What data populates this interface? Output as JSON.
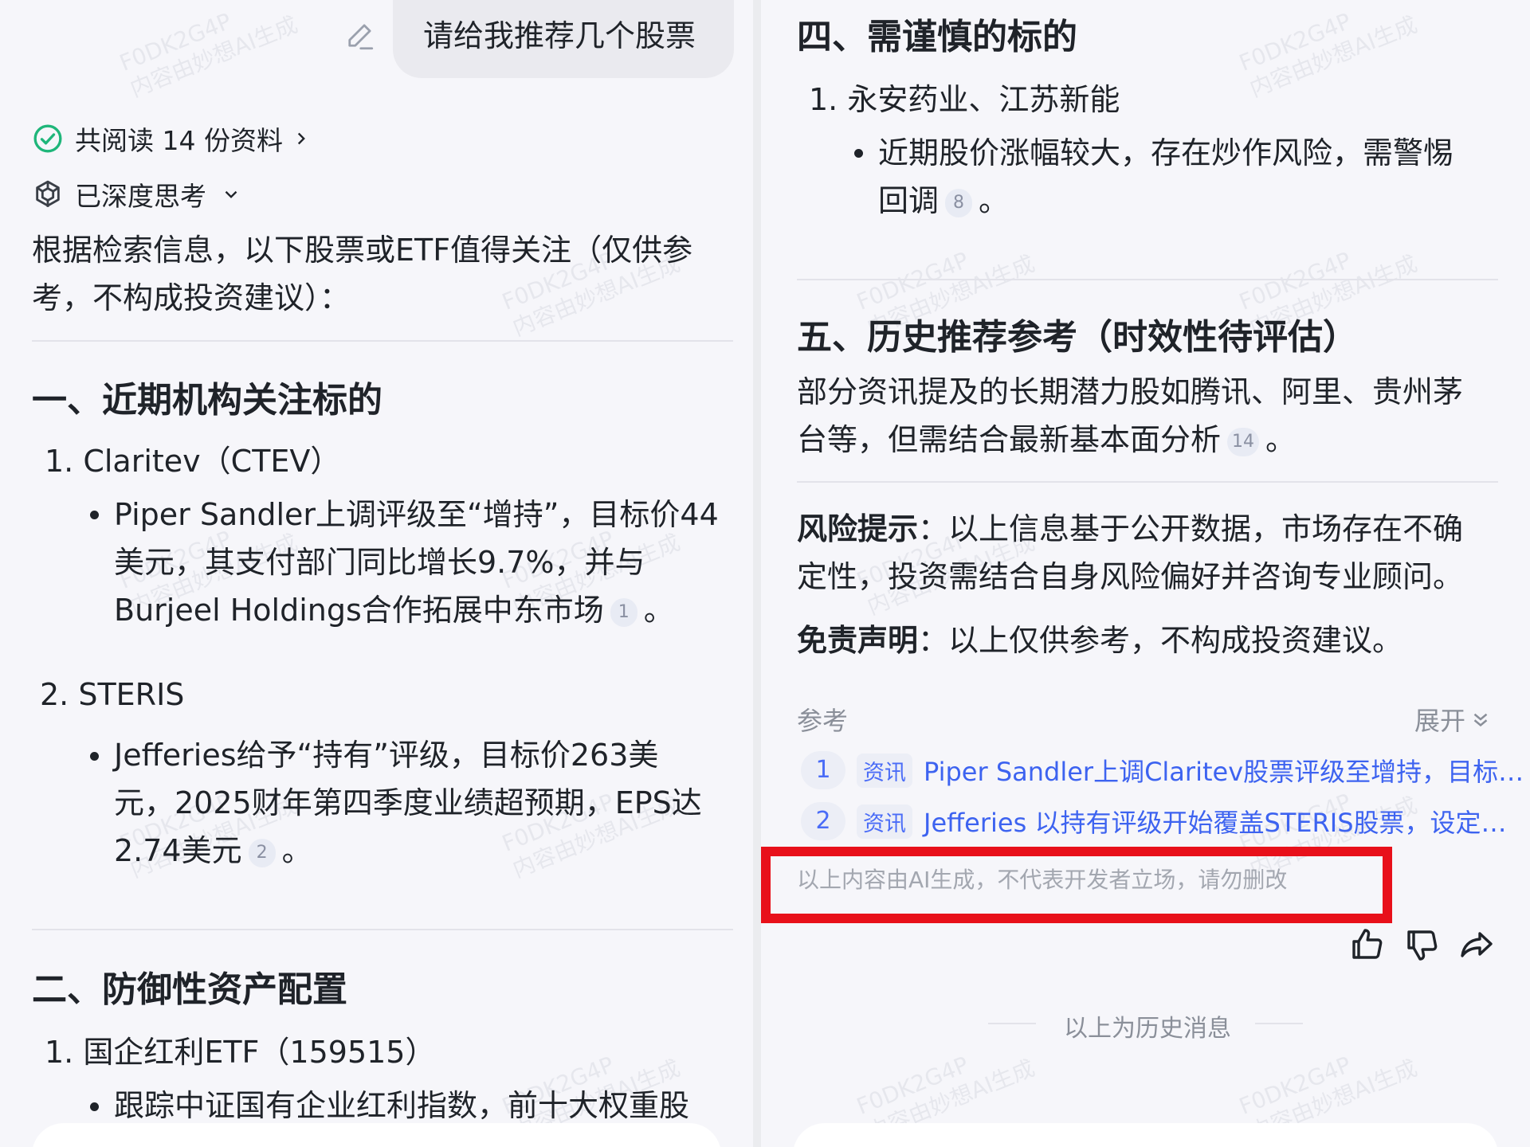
{
  "watermark": {
    "line1": "F0DK2G4P",
    "line2": "内容由妙想AI生成"
  },
  "left": {
    "user_message": "请给我推荐几个股票",
    "meta": {
      "read_sources": "共阅读 14 份资料",
      "deep_thought": "已深度思考"
    },
    "intro_line1": "根据检索信息，以下股票或ETF值得关注（仅供参",
    "intro_line2": "考，不构成投资建议）：",
    "section1": {
      "title": "一、近期机构关注标的",
      "item1_title": "1. Claritev（CTEV）",
      "item1_line1": "Piper Sandler上调评级至“增持”，目标价44",
      "item1_line2": "美元，其支付部门同比增长9.7%，并与",
      "item1_line3": "Burjeel Holdings合作拓展中东市场",
      "item1_cite": "1",
      "item1_end": "。",
      "item2_title": "2. STERIS",
      "item2_line1": "Jefferies给予“持有”评级，目标价263美",
      "item2_line2": "元，2025财年第四季度业绩超预期，EPS达",
      "item2_line3": "2.74美元",
      "item2_cite": "2",
      "item2_end": "。"
    },
    "section2": {
      "title": "二、防御性资产配置",
      "item1_title": "1. 国企红利ETF（159515）",
      "item1_line1": "跟踪中证国有企业红利指数，前十大权重股"
    }
  },
  "right": {
    "section4": {
      "title": "四、需谨慎的标的",
      "item1_title": "1. 永安药业、江苏新能",
      "item1_line1": "近期股价涨幅较大，存在炒作风险，需警惕",
      "item1_line2": "回调",
      "item1_cite": "8",
      "item1_end": "。"
    },
    "section5": {
      "title": "五、历史推荐参考（时效性待评估）",
      "line1": "部分资讯提及的长期潜力股如腾讯、阿里、贵州茅",
      "line2": "台等，但需结合最新基本面分析",
      "cite": "14",
      "end": "。"
    },
    "risk": {
      "label": "风险提示",
      "colon": "：",
      "line1": "以上信息基于公开数据，市场存在不确",
      "line2": "定性，投资需结合自身风险偏好并咨询专业顾问。"
    },
    "disclaimer": {
      "label": "免责声明",
      "colon": "：",
      "text": "以上仅供参考，不构成投资建议。"
    },
    "references": {
      "label": "参考",
      "expand": "展开",
      "items": [
        {
          "num": "1",
          "tag": "资讯",
          "title": "Piper Sandler上调Claritev股票评级至增持，目标…"
        },
        {
          "num": "2",
          "tag": "资讯",
          "title": "Jefferies 以持有评级开始覆盖STERIS股票，设定…"
        }
      ]
    },
    "ai_notice": "以上内容由AI生成，不代表开发者立场，请勿删改",
    "history_label": "以上为历史消息",
    "colors": {
      "highlight_box": "#e8101a",
      "link": "#3d63f0",
      "check_green": "#1fb67a"
    }
  }
}
